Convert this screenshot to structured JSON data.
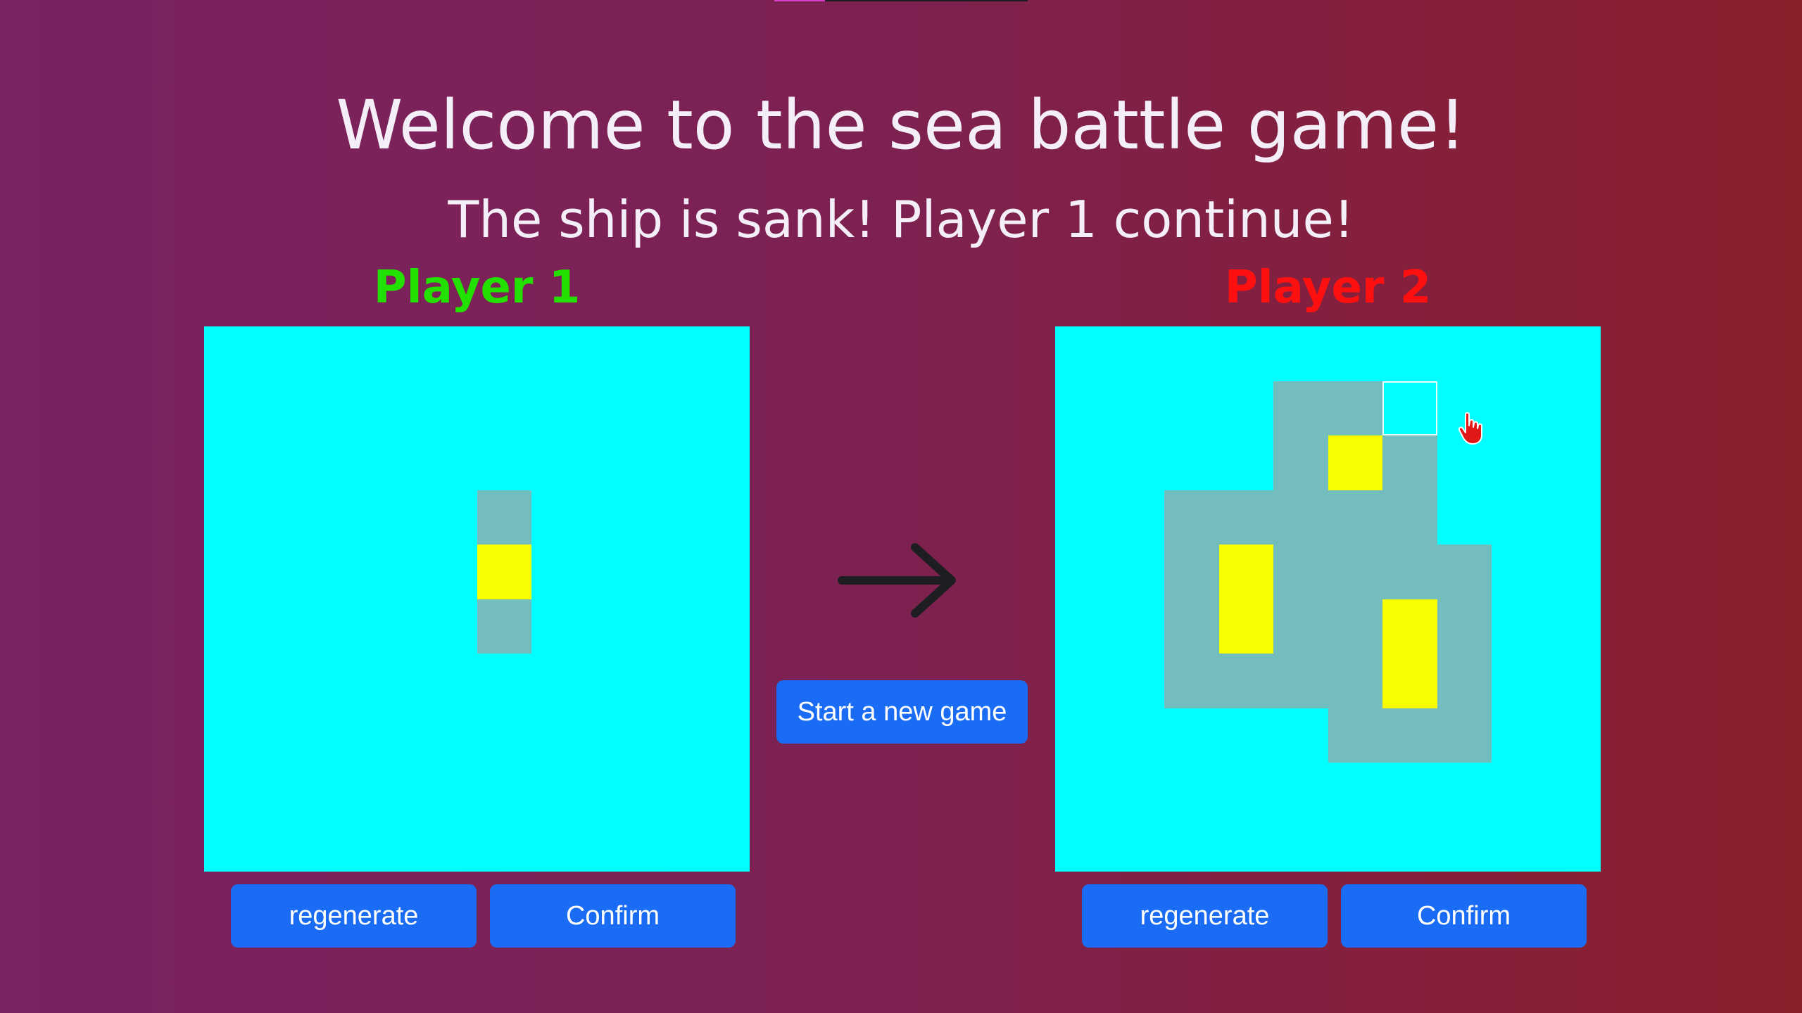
{
  "header": {
    "title": "Welcome to the sea battle game!",
    "status": "The ship is sank! Player 1 continue!"
  },
  "players": [
    {
      "label": "Player 1",
      "color": "#22e000",
      "regenerate_label": "regenerate",
      "confirm_label": "Confirm",
      "cells": [
        {
          "row": 3,
          "col": 5,
          "state": "miss"
        },
        {
          "row": 4,
          "col": 5,
          "state": "hit"
        },
        {
          "row": 5,
          "col": 5,
          "state": "miss"
        }
      ]
    },
    {
      "label": "Player 2",
      "color": "#ff1010",
      "regenerate_label": "regenerate",
      "confirm_label": "Confirm",
      "cells": [
        {
          "row": 1,
          "col": 4,
          "state": "miss"
        },
        {
          "row": 1,
          "col": 5,
          "state": "miss"
        },
        {
          "row": 1,
          "col": 6,
          "state": "hover"
        },
        {
          "row": 2,
          "col": 4,
          "state": "miss"
        },
        {
          "row": 2,
          "col": 5,
          "state": "hit"
        },
        {
          "row": 2,
          "col": 6,
          "state": "miss"
        },
        {
          "row": 3,
          "col": 2,
          "state": "miss"
        },
        {
          "row": 3,
          "col": 3,
          "state": "miss"
        },
        {
          "row": 3,
          "col": 4,
          "state": "miss"
        },
        {
          "row": 3,
          "col": 5,
          "state": "miss"
        },
        {
          "row": 3,
          "col": 6,
          "state": "miss"
        },
        {
          "row": 4,
          "col": 2,
          "state": "miss"
        },
        {
          "row": 4,
          "col": 3,
          "state": "hit"
        },
        {
          "row": 4,
          "col": 4,
          "state": "miss"
        },
        {
          "row": 4,
          "col": 5,
          "state": "miss"
        },
        {
          "row": 4,
          "col": 6,
          "state": "miss"
        },
        {
          "row": 4,
          "col": 7,
          "state": "miss"
        },
        {
          "row": 5,
          "col": 2,
          "state": "miss"
        },
        {
          "row": 5,
          "col": 3,
          "state": "hit"
        },
        {
          "row": 5,
          "col": 4,
          "state": "miss"
        },
        {
          "row": 5,
          "col": 5,
          "state": "miss"
        },
        {
          "row": 5,
          "col": 6,
          "state": "hit"
        },
        {
          "row": 5,
          "col": 7,
          "state": "miss"
        },
        {
          "row": 6,
          "col": 2,
          "state": "miss"
        },
        {
          "row": 6,
          "col": 3,
          "state": "miss"
        },
        {
          "row": 6,
          "col": 4,
          "state": "miss"
        },
        {
          "row": 6,
          "col": 5,
          "state": "miss"
        },
        {
          "row": 6,
          "col": 6,
          "state": "hit"
        },
        {
          "row": 6,
          "col": 7,
          "state": "miss"
        },
        {
          "row": 7,
          "col": 5,
          "state": "miss"
        },
        {
          "row": 7,
          "col": 6,
          "state": "miss"
        },
        {
          "row": 7,
          "col": 7,
          "state": "miss"
        }
      ]
    }
  ],
  "board": {
    "grid_size": 10,
    "water_color": "#00ffff",
    "miss_color": "#74bdbe",
    "hit_color": "#f8ff00"
  },
  "controls": {
    "new_game_label": "Start a new game",
    "arrow_icon": "arrow-right-icon",
    "button_color": "#1a6cf4"
  },
  "cursor": {
    "icon": "hand-pointer-icon"
  }
}
